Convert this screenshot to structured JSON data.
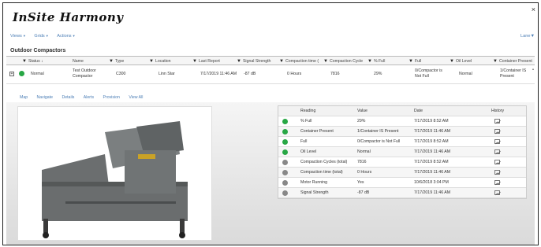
{
  "app": {
    "logo_text": "InSite Harmony",
    "close_symbol": "×"
  },
  "menu": {
    "items": [
      {
        "label": "Views"
      },
      {
        "label": "Grids"
      },
      {
        "label": "Actions"
      }
    ],
    "user": "Lane"
  },
  "section": {
    "title": "Outdoor Compactors"
  },
  "grid": {
    "columns": [
      "Status",
      "Name",
      "Type",
      "Location",
      "Last Report",
      "Signal Strength",
      "Compaction time (",
      "Compaction Cycle",
      "% Full",
      "Full",
      "Oil Level",
      "Container Present"
    ],
    "sort_indicator": "↓",
    "row": {
      "status": "Normal",
      "name": "Test Outdoor Compactor",
      "type": "C300",
      "location": "Linn Star",
      "last_report": "7/17/2019 11:46 AM",
      "signal_strength": "-87 dB",
      "compaction_time": "0 Hours",
      "compaction_cycles": "7816",
      "pct_full": "29%",
      "full": "0/Compactor is Not Full",
      "oil_level": "Normal",
      "container_present": "1/Container IS Present",
      "status_color": "#28a745"
    }
  },
  "detail": {
    "tabs": [
      "Map",
      "Navigate",
      "Details",
      "Alerts",
      "Provision",
      "View All"
    ],
    "readings_headers": [
      "Reading",
      "Value",
      "Date",
      "History"
    ],
    "readings": [
      {
        "reading": "% Full",
        "value": "29%",
        "date": "7/17/2019 8:52 AM",
        "color": "#28a745"
      },
      {
        "reading": "Container Present",
        "value": "1/Container IS Present",
        "date": "7/17/2019 11:46 AM",
        "color": "#28a745"
      },
      {
        "reading": "Full",
        "value": "0/Compactor is Not Full",
        "date": "7/17/2019 8:52 AM",
        "color": "#28a745"
      },
      {
        "reading": "Oil Level",
        "value": "Normal",
        "date": "7/17/2019 11:46 AM",
        "color": "#28a745"
      },
      {
        "reading": "Compaction Cycles (total)",
        "value": "7816",
        "date": "7/17/2019 8:52 AM",
        "color": "#888888"
      },
      {
        "reading": "Compaction time (total)",
        "value": "0 Hours",
        "date": "7/17/2019 11:46 AM",
        "color": "#888888"
      },
      {
        "reading": "Motor Running",
        "value": "Yes",
        "date": "10/6/2018 3:04 PM",
        "color": "#888888"
      },
      {
        "reading": "Signal Strength",
        "value": "-87 dB",
        "date": "7/17/2019 11:46 AM",
        "color": "#888888"
      }
    ],
    "photo_icon": "compactor-photo"
  }
}
